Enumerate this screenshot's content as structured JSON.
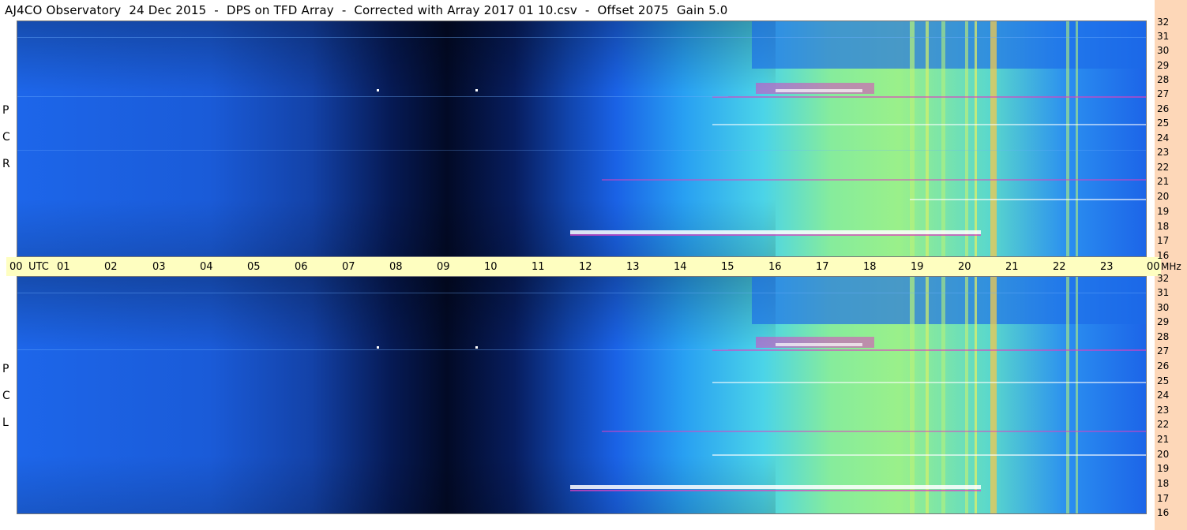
{
  "title": "AJ4CO Observatory  24 Dec 2015  -  DPS on TFD Array  -  Corrected with Array 2017 01 10.csv  -  Offset 2075  Gain 5.0",
  "panels": [
    {
      "letters": [
        "R",
        "C",
        "P"
      ]
    },
    {
      "letters": [
        "L",
        "C",
        "P"
      ]
    }
  ],
  "time_axis": {
    "labels": [
      "00",
      "UTC",
      "01",
      "02",
      "03",
      "04",
      "05",
      "06",
      "07",
      "08",
      "09",
      "10",
      "11",
      "12",
      "13",
      "14",
      "15",
      "16",
      "17",
      "18",
      "19",
      "20",
      "21",
      "22",
      "23",
      "00",
      "MHz"
    ]
  },
  "freq_axis": {
    "labels": [
      "32",
      "31",
      "30",
      "29",
      "28",
      "27",
      "26",
      "25",
      "24",
      "23",
      "22",
      "21",
      "20",
      "19",
      "18",
      "17",
      "16"
    ]
  },
  "colors": {
    "background_blue": "#1a5fe6",
    "deep_night": "#020b2a",
    "time_axis_bg": "#fefec0",
    "freq_strip_bg": "#fdd7b8",
    "solar_green": "#8ef08a",
    "interference_magenta": "#e040c0"
  }
}
